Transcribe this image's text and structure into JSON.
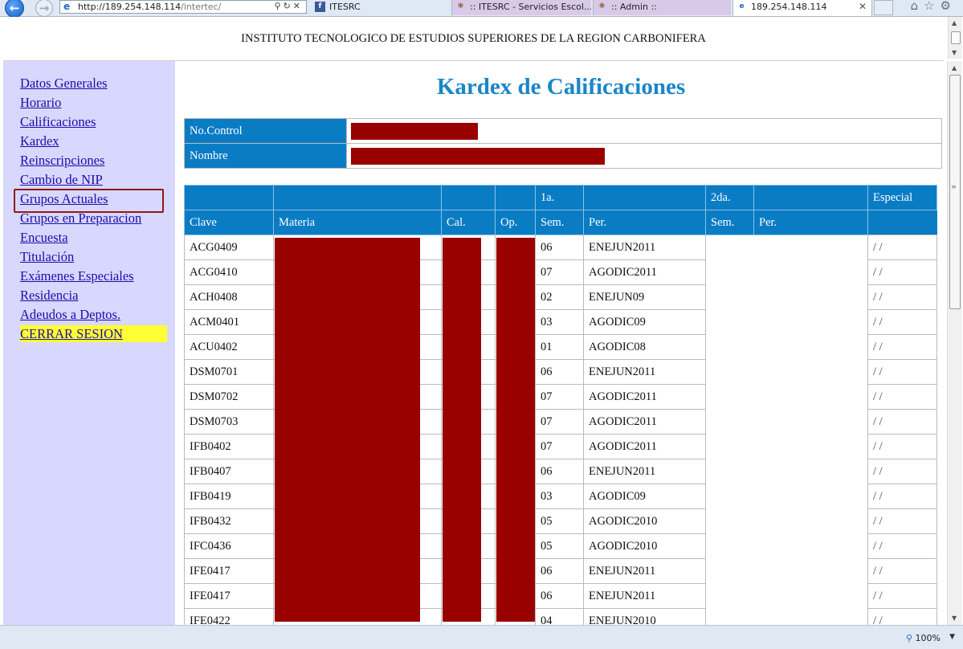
{
  "browser": {
    "url_host": "http://189.254.148.114",
    "url_path": "/intertec/",
    "tabs": [
      {
        "label": "ITESRC"
      },
      {
        "label": ":: ITESRC - Servicios Escol..."
      },
      {
        "label": ":: Admin ::"
      },
      {
        "label": "189.254.148.114"
      }
    ],
    "zoom": "100%"
  },
  "header": {
    "title": "INSTITUTO TECNOLOGICO DE ESTUDIOS SUPERIORES DE LA REGION CARBONIFERA"
  },
  "sidebar": {
    "items": [
      {
        "label": "Datos Generales"
      },
      {
        "label": "Horario"
      },
      {
        "label": "Calificaciones"
      },
      {
        "label": "Kardex"
      },
      {
        "label": "Reinscripciones"
      },
      {
        "label": "Cambio de NIP"
      },
      {
        "label": "Grupos Actuales"
      },
      {
        "label": "Grupos en Preparacion"
      },
      {
        "label": "Encuesta"
      },
      {
        "label": "Titulación"
      },
      {
        "label": "Exámenes Especiales"
      },
      {
        "label": "Residencia"
      },
      {
        "label": "Adeudos a Deptos."
      },
      {
        "label": "CERRAR SESION"
      }
    ]
  },
  "main": {
    "title": "Kardex de Calificaciones",
    "info": {
      "control_label": "No.Control",
      "name_label": "Nombre"
    },
    "table": {
      "group_headers": {
        "first": "1a.",
        "second": "2da.",
        "special": "Especial"
      },
      "headers": {
        "clave": "Clave",
        "materia": "Materia",
        "cal": "Cal.",
        "op": "Op.",
        "sem1": "Sem.",
        "per1": "Per.",
        "sem2": "Sem.",
        "per2": "Per."
      },
      "rows": [
        {
          "clave": "ACG0409",
          "sem": "06",
          "per": "ENEJUN2011",
          "esp": "/ /"
        },
        {
          "clave": "ACG0410",
          "sem": "07",
          "per": "AGODIC2011",
          "esp": "/ /"
        },
        {
          "clave": "ACH0408",
          "sem": "02",
          "per": "ENEJUN09",
          "esp": "/ /"
        },
        {
          "clave": "ACM0401",
          "sem": "03",
          "per": "AGODIC09",
          "esp": "/ /"
        },
        {
          "clave": "ACU0402",
          "sem": "01",
          "per": "AGODIC08",
          "esp": "/ /"
        },
        {
          "clave": "DSM0701",
          "sem": "06",
          "per": "ENEJUN2011",
          "esp": "/ /"
        },
        {
          "clave": "DSM0702",
          "sem": "07",
          "per": "AGODIC2011",
          "esp": "/ /"
        },
        {
          "clave": "DSM0703",
          "sem": "07",
          "per": "AGODIC2011",
          "esp": "/ /"
        },
        {
          "clave": "IFB0402",
          "sem": "07",
          "per": "AGODIC2011",
          "esp": "/ /"
        },
        {
          "clave": "IFB0407",
          "sem": "06",
          "per": "ENEJUN2011",
          "esp": "/ /"
        },
        {
          "clave": "IFB0419",
          "sem": "03",
          "per": "AGODIC09",
          "esp": "/ /"
        },
        {
          "clave": "IFB0432",
          "sem": "05",
          "per": "AGODIC2010",
          "esp": "/ /"
        },
        {
          "clave": "IFC0436",
          "sem": "05",
          "per": "AGODIC2010",
          "esp": "/ /"
        },
        {
          "clave": "IFE0417",
          "sem": "06",
          "per": "ENEJUN2011",
          "esp": "/ /"
        },
        {
          "clave": "IFE0417",
          "sem": "06",
          "per": "ENEJUN2011",
          "esp": "/ /"
        },
        {
          "clave": "IFE0422",
          "sem": "04",
          "per": "ENEJUN2010",
          "esp": "/ /"
        }
      ]
    }
  }
}
